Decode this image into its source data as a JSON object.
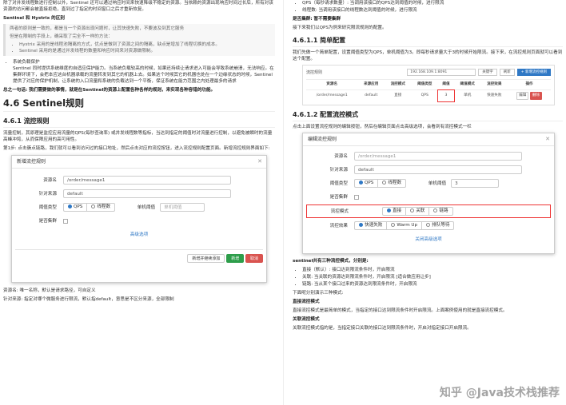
{
  "left": {
    "intro": "除了对并发线程数进行控制以外，Sentinel 还可以通过响应时间来快速降级不稳定的资源。当依赖的资源出现响应时间过长后，所有对该资源的访问都会被直接拒绝，直到过了指定的时间窗口之后才重新恢复。",
    "compare_title": "Sentinel 和 Hystrix 的区别",
    "quote_p1": "两者的原则是一致的，都是当一个资源出现问题时，让其快速失败，不要波及到其它服务",
    "quote_p2": "但是在限制的手段上，确采取了完全不一样的方法：",
    "quote_b1": "Hystrix 采用的是线程池隔离的方式，优点是做到了资源之间的隔离，缺点是增加了线程切换的成本。",
    "quote_b2": "Sentinel 采用的是通过并发线程的数量和响应时间来对资源做限制。",
    "sys_title": "系统负载保护",
    "sys_text": "Sentinel 同时提供系统维度的自适应保护能力。当系统负载较高的时候，如果还持续让请求进入可能会导致系统崩溃，无法响应。在集群环境下，会把本应这台机器承载的流量转发到其它的机器上去。如果这个时候其它的机器也处在一个边缘状态的时候，Sentinel 提供了对应的保护机制，让系统的入口流量和系统的负载达到一个平衡，保证系统在能力范围之内处理最多的请求",
    "summary": "总之一句话: 我们需要做的事情，就是在Sentinel的资源上配置各种各样的规则，来实现各种容错的功能。",
    "h2": "4.6 Sentinel规则",
    "h3": "4.6.1 流控规则",
    "flow_text": "流量控制，其原理是监控应用流量的QPS(每秒查询率) 或并发线程数等指标，当达到指定的阈值时对流量进行控制，以避免被瞬时的流量高峰冲垮，从而保障应用的高可用性。",
    "step1": "第1步: 点击簇点链路，我们就可以看到访问过的接口地址，然后点击对应的流控按钮，进入流控规则配置页面。新增流控规则界面如下:",
    "dialog": {
      "title": "新增流控规则",
      "resource_label": "资源名",
      "resource_value": "/order/message1",
      "origin_label": "针对来源",
      "origin_value": "default",
      "type_label": "阈值类型",
      "type_opt1": "QPS",
      "type_opt2": "线程数",
      "single_label": "单机阈值",
      "single_placeholder": "单机阈值",
      "cluster_label": "是否集群",
      "advanced_link": "高级选项",
      "btn_add_continue": "新增并继续添加",
      "btn_add": "新增",
      "btn_cancel": "取消"
    },
    "foot1": "资源名: 唯一名称，默认是请求路径，可自定义",
    "foot2": "针对来源: 指定对哪个微服务进行限流，默认指default，意思是不区分来源，全部限制"
  },
  "right": {
    "b1": "QPS（每秒请求数量）: 当调用该接口的QPS达到阈值的时候，进行限流",
    "b2": "线程数: 当调用该接口的线程数达到阈值的时候，进行限流",
    "adv_note": "是否集群: 暂不需要集群",
    "intro2": "接下来我们以QPS为例来研究限流规则的配置。",
    "h_simple": "4.6.1.1 简单配置",
    "simple_text": "我们先做一个简单配置，设置阈值类型为QPS，单机阈值为3。即每秒请求量大于3的时候开始限流。接下来，在流控规则页面就可以看到这个配置。",
    "table": {
      "title": "流控规则",
      "select": "192.168.109.1:8091",
      "btn_search": "关键字",
      "btn_refresh": "刷新",
      "btn_add": "+ 新增流控规则",
      "headers": [
        "资源名",
        "来源应用",
        "流控模式",
        "阈值类型",
        "阈值",
        "阈值模式",
        "流控效果",
        "操作"
      ],
      "row": [
        "/order/message1",
        "default",
        "直接",
        "QPS",
        "3",
        "单机",
        "快速失败",
        "编辑",
        "删除"
      ]
    },
    "h_mode": "4.6.1.2 配置流控模式",
    "mode_text": "点击上面设置流控规则的编辑按钮，然后在编辑页面点击高级选项，会看到有流控模式一栏",
    "dialog2": {
      "title": "编辑流控规则",
      "resource_label": "资源名",
      "resource_value": "/order/message1",
      "origin_label": "针对来源",
      "origin_value": "default",
      "type_label": "阈值类型",
      "type_opt1": "QPS",
      "type_opt2": "线程数",
      "single_label": "单机阈值",
      "single_value": "3",
      "cluster_label": "是否集群",
      "mode_label": "流控模式",
      "mode_opt1": "直接",
      "mode_opt2": "关联",
      "mode_opt3": "链路",
      "effect_label": "流控效果",
      "effect_opt1": "快速失败",
      "effect_opt2": "Warm Up",
      "effect_opt3": "排队等待",
      "close_advanced": "关闭高级选项"
    },
    "modes_intro": "sentinel共有三种流控模式，分别是:",
    "mode_b1": "直接（默认）: 接口达到限流条件时，开启限流",
    "mode_b2": "关联: 当关联的资源达到限流条件时，开启限流 [适合做应用让步]",
    "mode_b3": "链路: 当从某个接口过来的资源达到限流条件时，开启限流",
    "next": "下面呢分别演示三种模式:",
    "direct_title": "直接流控模式",
    "direct_text": "直接流控模式是最简单的模式，当指定的接口达到限流条件时开启限流。上面案例使用的就是直接流控模式。",
    "assoc_title": "关联流控模式",
    "assoc_text": "关联流控模式指的是，当指定接口关联的接口达到限流条件时，开启对指定接口开启限流。"
  },
  "watermark": "知乎 @Java技术栈推荐"
}
